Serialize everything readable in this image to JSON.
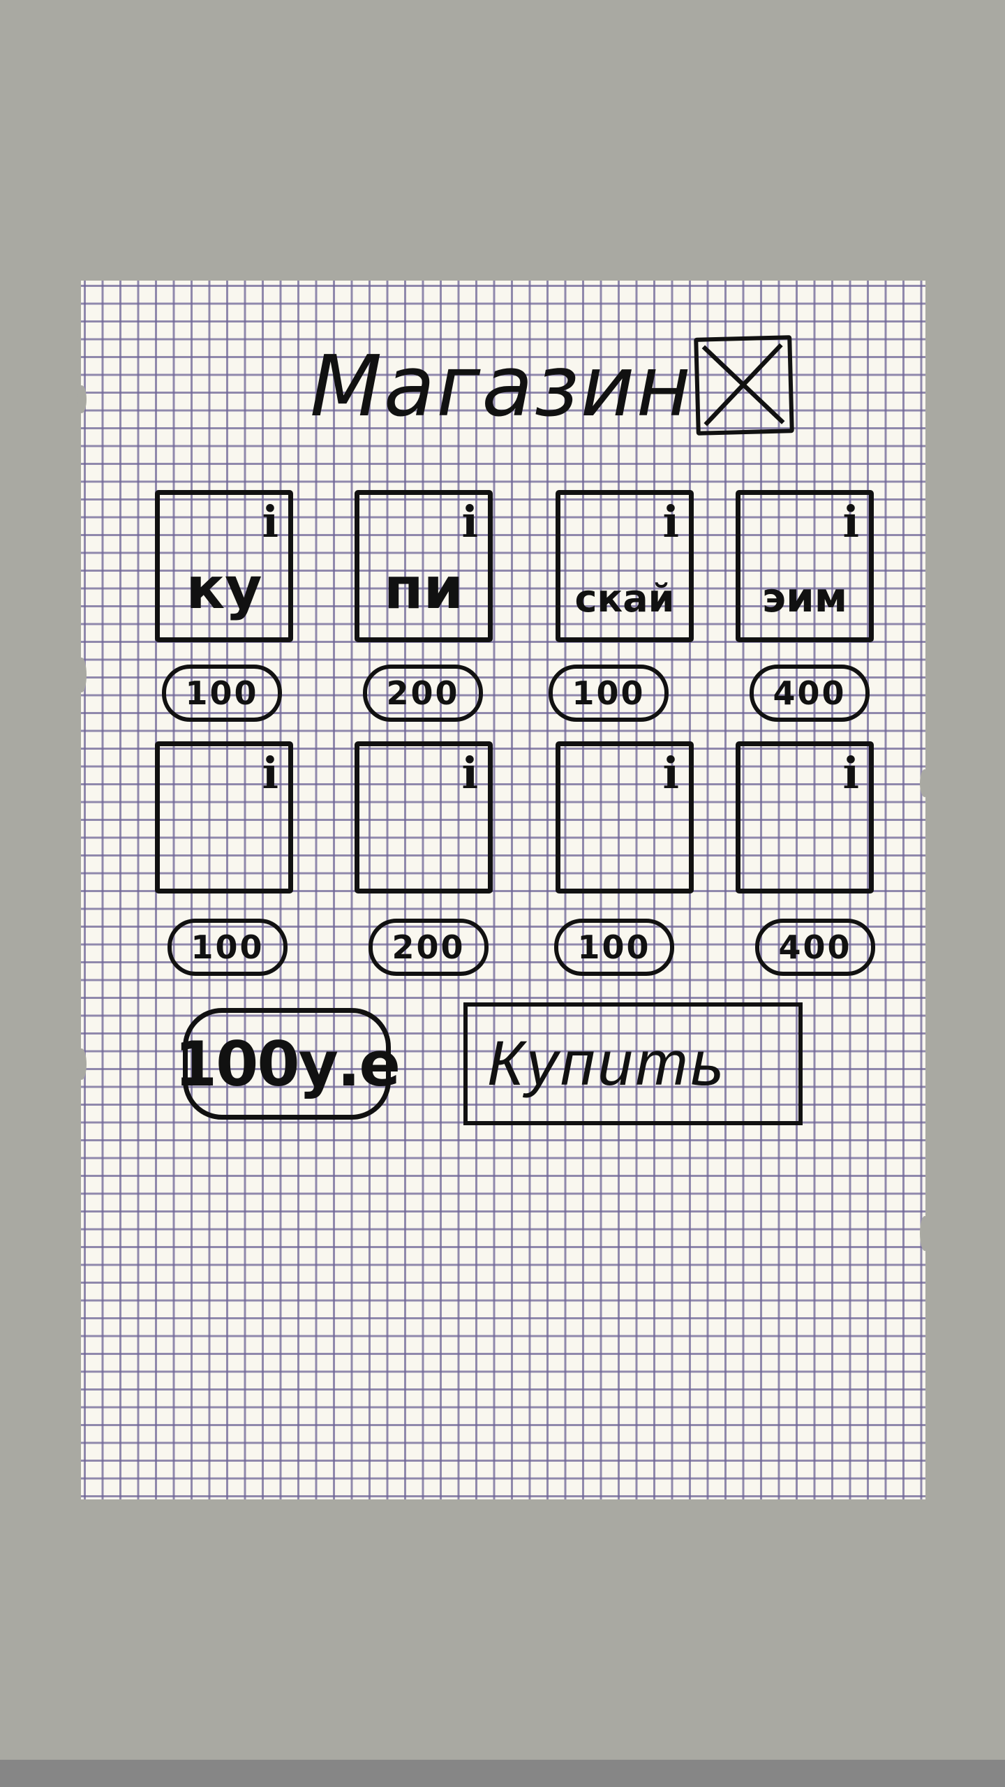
{
  "shop": {
    "title": "Магазин",
    "close": {
      "icon": "close-x-icon"
    },
    "info_symbol": "i",
    "items": [
      {
        "name": "ку",
        "price": "100"
      },
      {
        "name": "пи",
        "price": "200"
      },
      {
        "name": "скай",
        "price": "100"
      },
      {
        "name": "эим",
        "price": "400"
      },
      {
        "name": "",
        "price": "100"
      },
      {
        "name": "",
        "price": "200"
      },
      {
        "name": "",
        "price": "100"
      },
      {
        "name": "",
        "price": "400"
      }
    ],
    "balance": "100у.е",
    "buy_label": "Купить"
  },
  "colors": {
    "background": "#a9a9a2",
    "paper": "#f9f7ef",
    "grid": "#6e6496",
    "ink": "#111111"
  }
}
